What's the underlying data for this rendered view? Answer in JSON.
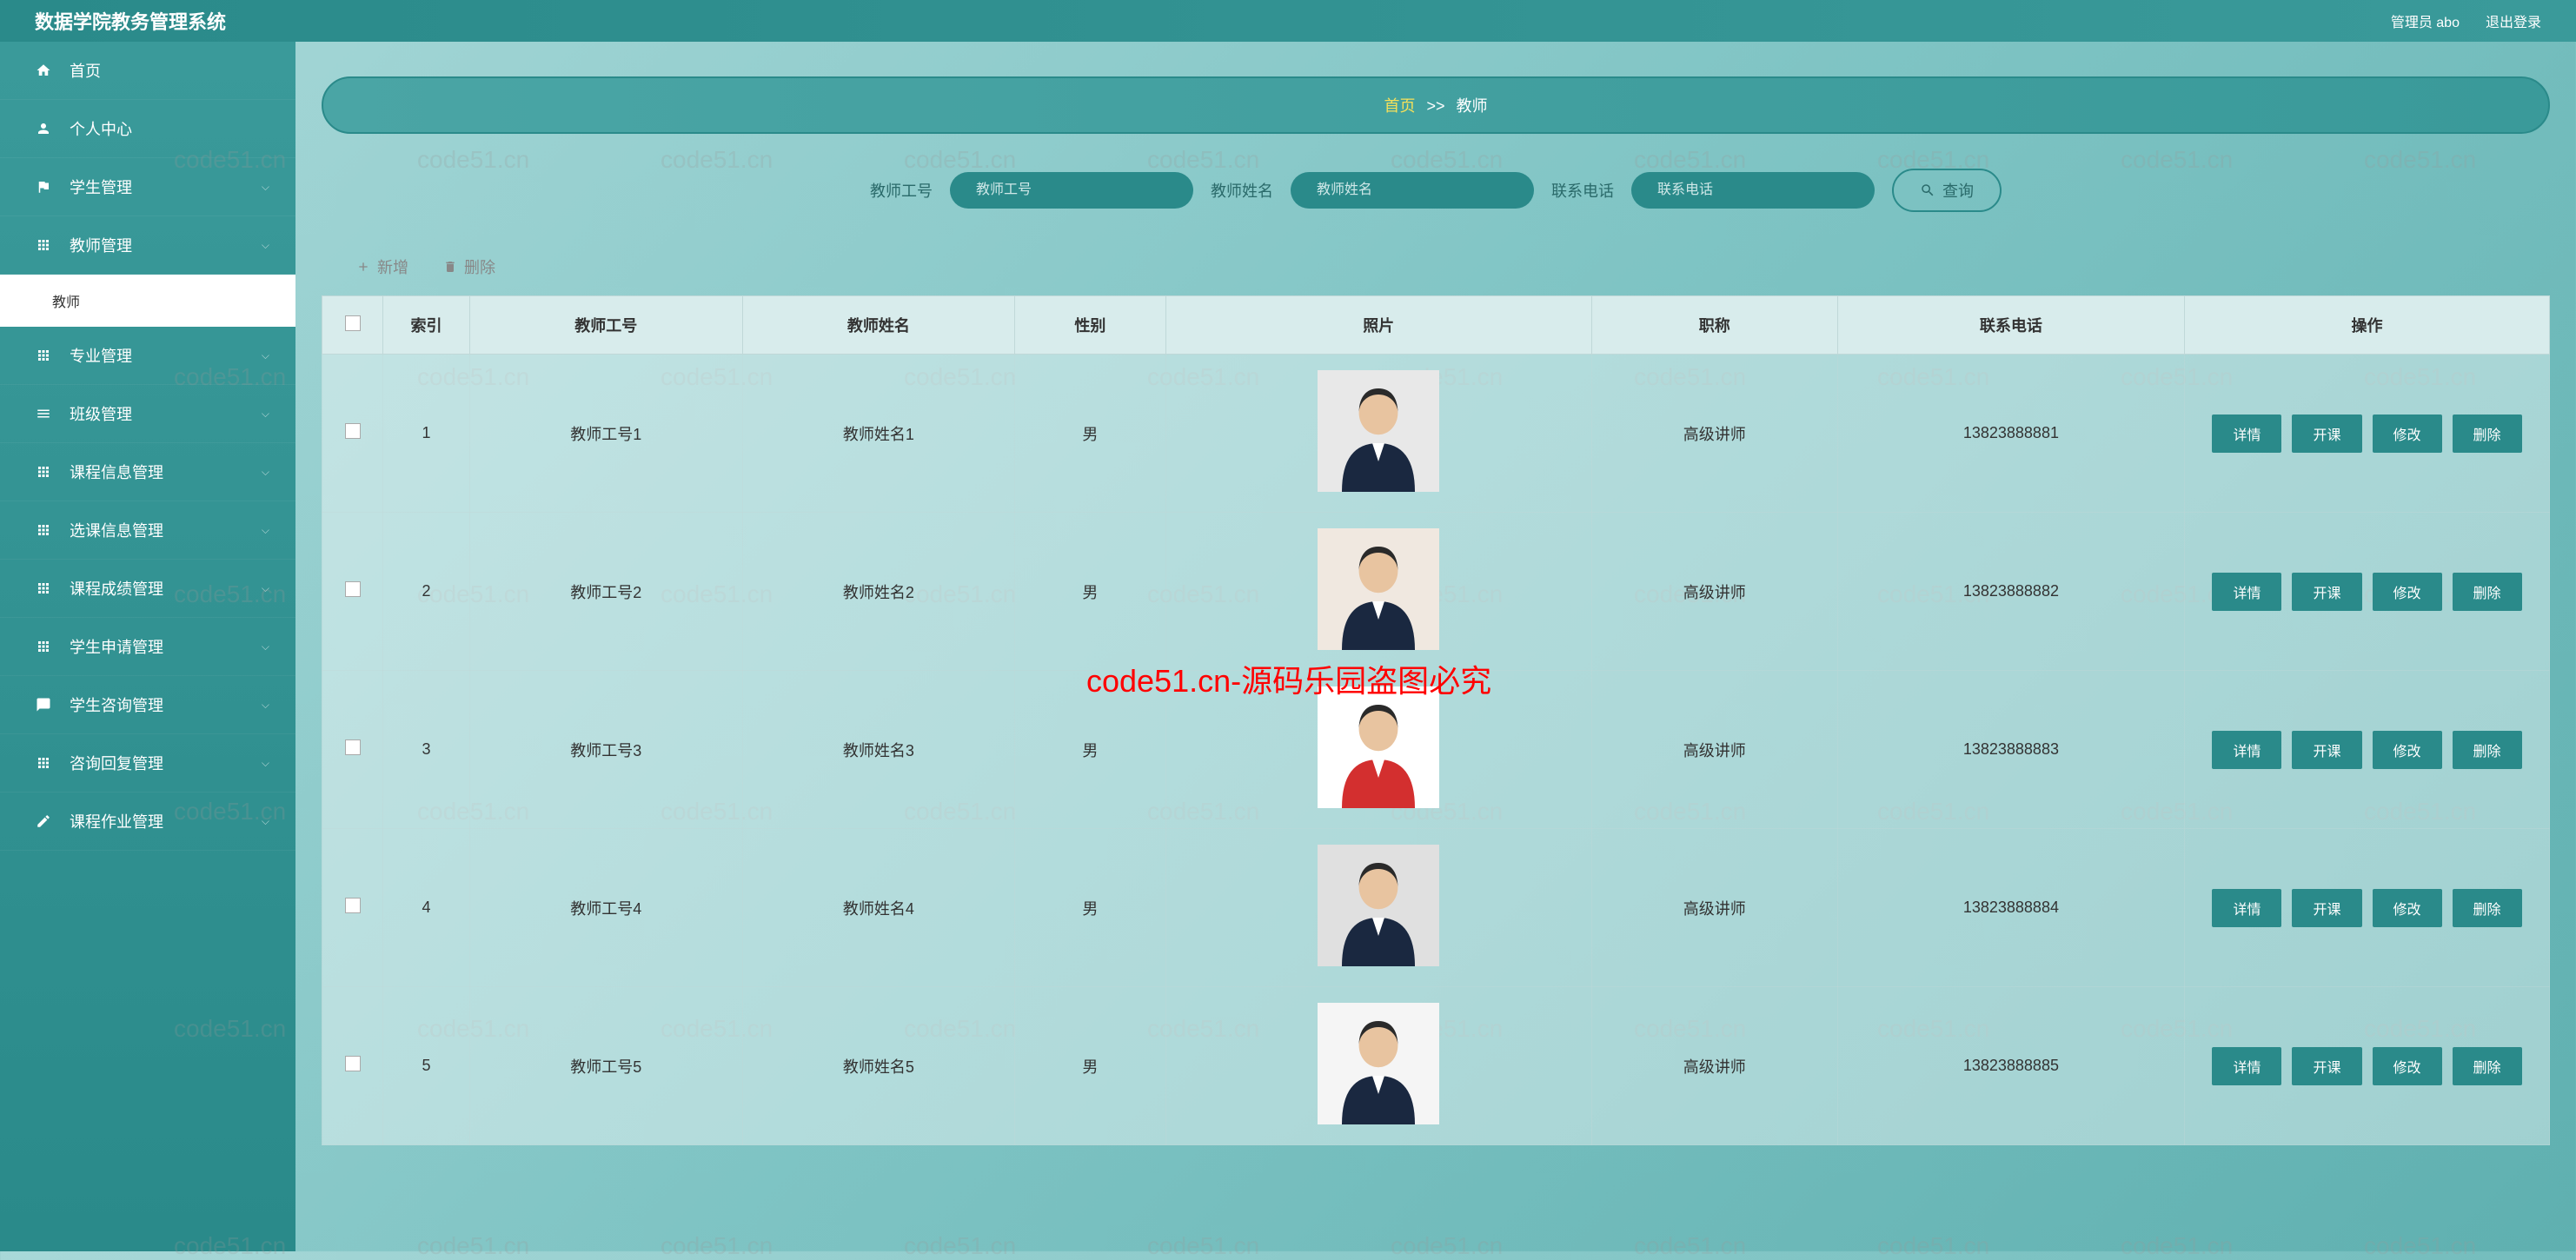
{
  "app_title": "数据学院教务管理系统",
  "topbar": {
    "admin_label": "管理员 abo",
    "logout_label": "退出登录"
  },
  "sidebar": {
    "items": [
      {
        "icon": "home",
        "label": "首页"
      },
      {
        "icon": "user",
        "label": "个人中心"
      },
      {
        "icon": "flag",
        "label": "学生管理",
        "chev": true
      },
      {
        "icon": "grid",
        "label": "教师管理",
        "chev": true,
        "expanded": true,
        "sub": [
          {
            "label": "教师"
          }
        ]
      },
      {
        "icon": "grid",
        "label": "专业管理",
        "chev": true
      },
      {
        "icon": "list",
        "label": "班级管理",
        "chev": true
      },
      {
        "icon": "grid",
        "label": "课程信息管理",
        "chev": true
      },
      {
        "icon": "grid",
        "label": "选课信息管理",
        "chev": true
      },
      {
        "icon": "grid",
        "label": "课程成绩管理",
        "chev": true
      },
      {
        "icon": "grid",
        "label": "学生申请管理",
        "chev": true
      },
      {
        "icon": "chat",
        "label": "学生咨询管理",
        "chev": true
      },
      {
        "icon": "grid",
        "label": "咨询回复管理",
        "chev": true
      },
      {
        "icon": "pen",
        "label": "课程作业管理",
        "chev": true
      }
    ]
  },
  "breadcrumb": {
    "home": "首页",
    "sep": ">>",
    "current": "教师"
  },
  "search": {
    "id_label": "教师工号",
    "id_placeholder": "教师工号",
    "name_label": "教师姓名",
    "name_placeholder": "教师姓名",
    "phone_label": "联系电话",
    "phone_placeholder": "联系电话",
    "btn_label": "查询"
  },
  "toolbar": {
    "add_label": "新增",
    "delete_label": "删除"
  },
  "table": {
    "headers": {
      "checkbox": "",
      "index": "索引",
      "id": "教师工号",
      "name": "教师姓名",
      "gender": "性别",
      "photo": "照片",
      "title": "职称",
      "phone": "联系电话",
      "ops": "操作"
    },
    "ops": {
      "detail": "详情",
      "open": "开课",
      "edit": "修改",
      "del": "删除"
    },
    "rows": [
      {
        "index": "1",
        "id": "教师工号1",
        "name": "教师姓名1",
        "gender": "男",
        "title": "高级讲师",
        "phone": "13823888881",
        "photo": "m1"
      },
      {
        "index": "2",
        "id": "教师工号2",
        "name": "教师姓名2",
        "gender": "男",
        "title": "高级讲师",
        "phone": "13823888882",
        "photo": "f1"
      },
      {
        "index": "3",
        "id": "教师工号3",
        "name": "教师姓名3",
        "gender": "男",
        "title": "高级讲师",
        "phone": "13823888883",
        "photo": "f2"
      },
      {
        "index": "4",
        "id": "教师工号4",
        "name": "教师姓名4",
        "gender": "男",
        "title": "高级讲师",
        "phone": "13823888884",
        "photo": "m2"
      },
      {
        "index": "5",
        "id": "教师工号5",
        "name": "教师姓名5",
        "gender": "男",
        "title": "高级讲师",
        "phone": "13823888885",
        "photo": "f3"
      }
    ]
  },
  "watermark_main": "code51.cn-源码乐园盗图必究",
  "watermark_bg": "code51.cn"
}
